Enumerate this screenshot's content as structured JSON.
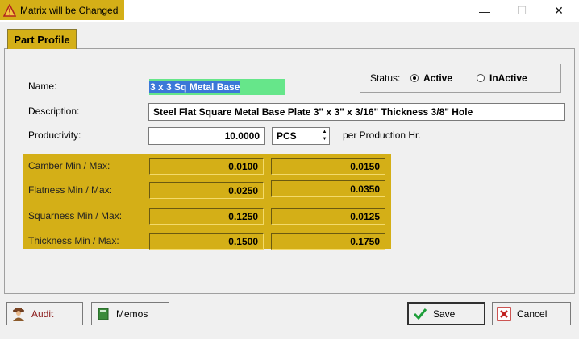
{
  "window": {
    "title": "Matrix will be Changed"
  },
  "tabs": [
    {
      "label": "Part Profile"
    }
  ],
  "form": {
    "name_label": "Name:",
    "name_value": "3 x 3 Sq Metal Base",
    "description_label": "Description:",
    "description_value": "Steel Flat Square Metal Base Plate 3\" x 3\" x 3/16\" Thickness 3/8\" Hole",
    "productivity_label": "Productivity:",
    "productivity_value": "10.0000",
    "unit_value": "PCS",
    "per_text": "per Production Hr."
  },
  "status": {
    "label": "Status:",
    "options": [
      {
        "label": "Active",
        "selected": true
      },
      {
        "label": "InActive",
        "selected": false
      }
    ]
  },
  "tolerances": [
    {
      "label": "Camber Min / Max:",
      "min": "0.0100",
      "max": "0.0150"
    },
    {
      "label": "Flatness Min / Max:",
      "min": "0.0250",
      "max": "0.0350"
    },
    {
      "label": "Squarness Min / Max:",
      "min": "0.1250",
      "max": "0.0125"
    },
    {
      "label": "Thickness Min / Max:",
      "min": "0.1500",
      "max": "0.1750"
    }
  ],
  "buttons": {
    "audit": "Audit",
    "memos": "Memos",
    "save": "Save",
    "cancel": "Cancel"
  },
  "colors": {
    "accent": "#d4af17",
    "selection": "#3b78d8",
    "highlight": "#66e68a"
  }
}
